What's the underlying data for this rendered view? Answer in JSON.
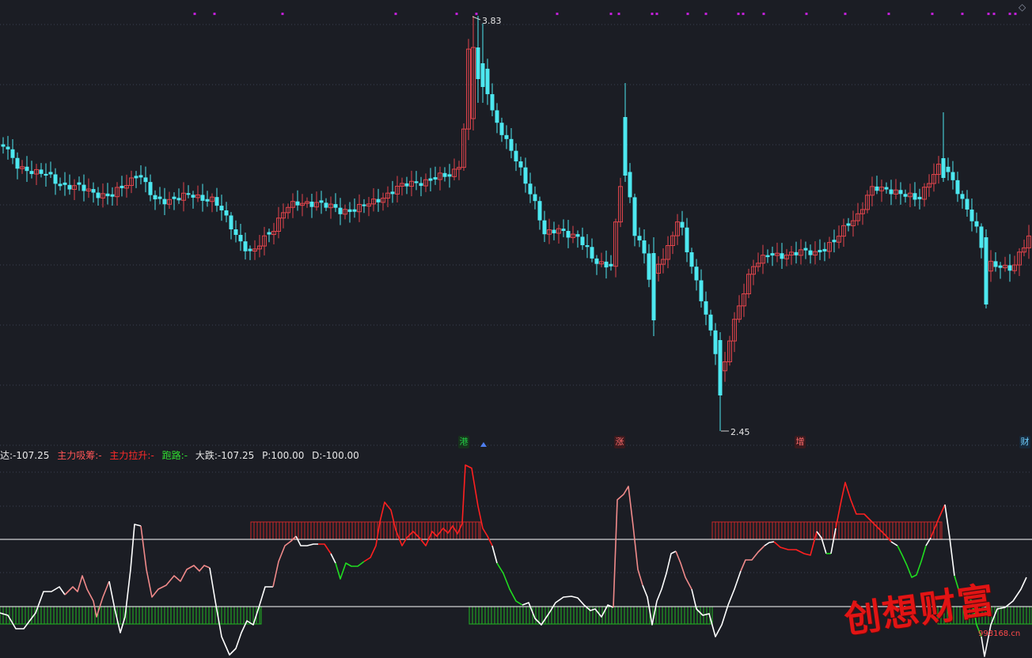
{
  "colors": {
    "background": "#1b1d24",
    "grid": "#3b4152",
    "up": "#e0444b",
    "down": "#4de8f0",
    "doji": "#ffffff",
    "marker": "#c020d8",
    "line_white": "#ffffff",
    "line_pink": "#f08a8a",
    "line_red": "#ff2020",
    "line_green": "#20dd20",
    "hist_red": "#c82828",
    "hist_green": "#22b822"
  },
  "price_chart": {
    "high_label": "3.83",
    "low_label": "2.45"
  },
  "tags": [
    {
      "text": "港",
      "name": "tag-gang",
      "color": "#22cc44",
      "bg": "#17321d"
    },
    {
      "text": "涨",
      "name": "tag-zhang",
      "color": "#ff6b6b",
      "bg": "#3a1a1e"
    },
    {
      "text": "增",
      "name": "tag-zeng",
      "color": "#ff6b6b",
      "bg": "#3a1a1e"
    },
    {
      "text": "财",
      "name": "tag-cai",
      "color": "#6fd0ff",
      "bg": "#17283a"
    }
  ],
  "indicator_legend": {
    "item1_label": "达:",
    "item1_value": "-107.25",
    "item2_label": "主力吸筹:",
    "item2_value": "-",
    "item3_label": "主力拉升:",
    "item3_value": "-",
    "item4_label": "跑路:",
    "item4_value": "-",
    "item5_label": "大跌:",
    "item5_value": "-107.25",
    "item6_label": "P:",
    "item6_value": "100.00",
    "item7_label": "D:",
    "item7_value": "-100.00"
  },
  "watermark": {
    "text": "创想财富",
    "url": "998168.cn"
  }
}
